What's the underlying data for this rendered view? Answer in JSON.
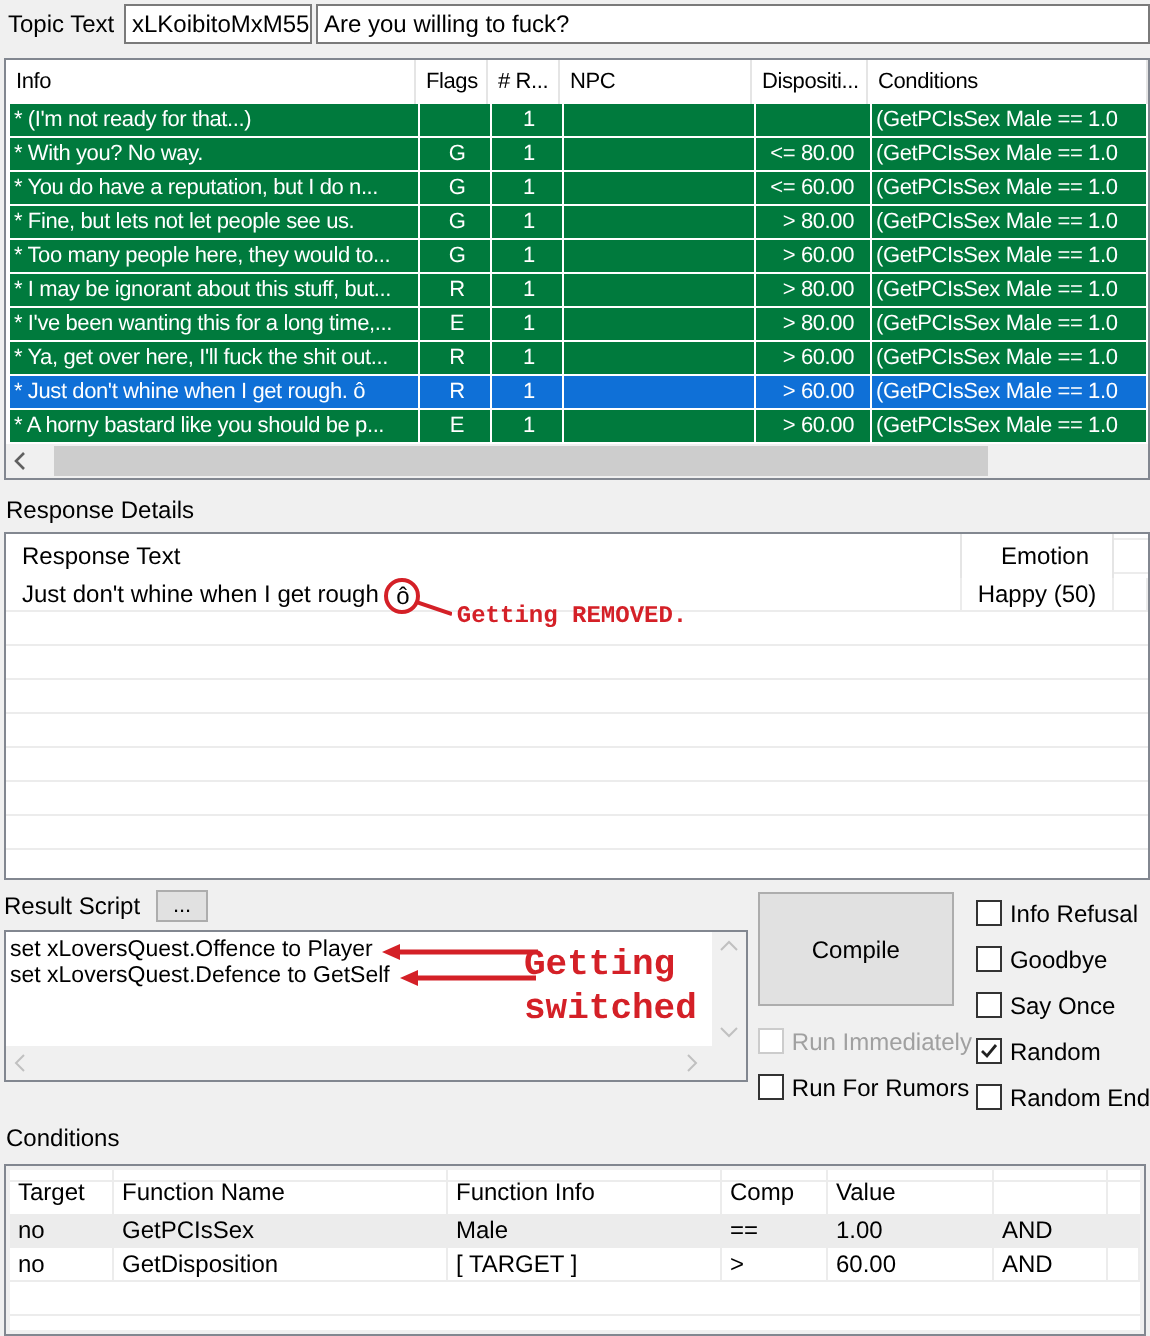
{
  "topic": {
    "label": "Topic Text",
    "id": "xLKoibitoMxM55",
    "text": "Are you willing to fuck?"
  },
  "info_table": {
    "columns": [
      "Info",
      "Flags",
      "# R...",
      "NPC",
      "Dispositi...",
      "Conditions"
    ],
    "rows": [
      {
        "info": "* (I'm not ready for that...)",
        "responses": "1",
        "conditions": "(GetPCIsSex Male == 1.0",
        "selected": false
      },
      {
        "info": "* With you? No way.",
        "flags": "G",
        "responses": "1",
        "disposition": "<= 80.00",
        "conditions": "(GetPCIsSex Male == 1.0",
        "selected": false
      },
      {
        "info": "* You do have  a reputation, but I do n...",
        "flags": "G",
        "responses": "1",
        "disposition": "<= 60.00",
        "conditions": "(GetPCIsSex Male == 1.0",
        "selected": false
      },
      {
        "info": "* Fine, but lets not let people see us.",
        "flags": "G",
        "responses": "1",
        "disposition": "> 80.00",
        "conditions": "(GetPCIsSex Male == 1.0",
        "selected": false
      },
      {
        "info": "* Too many people here, they would to...",
        "flags": "G",
        "responses": "1",
        "disposition": "> 60.00",
        "conditions": "(GetPCIsSex Male == 1.0",
        "selected": false
      },
      {
        "info": "* I may be ignorant about this stuff, but...",
        "flags": "R",
        "responses": "1",
        "disposition": "> 80.00",
        "conditions": "(GetPCIsSex Male == 1.0",
        "selected": false
      },
      {
        "info": "* I've been wanting this for a long time,...",
        "flags": "E",
        "responses": "1",
        "disposition": "> 80.00",
        "conditions": "(GetPCIsSex Male == 1.0",
        "selected": false
      },
      {
        "info": "* Ya, get over here, I'll fuck the shit out...",
        "flags": "R",
        "responses": "1",
        "disposition": "> 60.00",
        "conditions": "(GetPCIsSex Male == 1.0",
        "selected": false
      },
      {
        "info": "* Just don't whine when I get rough. ô",
        "flags": "R",
        "responses": "1",
        "disposition": "> 60.00",
        "conditions": "(GetPCIsSex Male == 1.0",
        "selected": true
      },
      {
        "info": "* A horny bastard like you should be p...",
        "flags": "E",
        "responses": "1",
        "disposition": "> 60.00",
        "conditions": "(GetPCIsSex Male == 1.0",
        "selected": false
      }
    ]
  },
  "response_details": {
    "label": "Response Details",
    "columns": [
      "Response Text",
      "Emotion"
    ],
    "rows": [
      {
        "text": "Just don't whine when I get rough",
        "circled": "ô",
        "emotion": "Happy (50)",
        "note": "Getting REMOVED."
      }
    ]
  },
  "result_script": {
    "label": "Result Script",
    "button": "...",
    "lines": [
      "set xLoversQuest.Offence to Player",
      "set xLoversQuest.Defence to GetSelf"
    ],
    "note": "Getting switched"
  },
  "compile_button": "Compile",
  "middle_checks": [
    {
      "label": "Run Immediately",
      "checked": false,
      "disabled": true
    },
    {
      "label": "Run For Rumors",
      "checked": false,
      "disabled": false
    }
  ],
  "flags": [
    {
      "label": "Info Refusal",
      "checked": false
    },
    {
      "label": "Goodbye",
      "checked": false
    },
    {
      "label": "Say Once",
      "checked": false
    },
    {
      "label": "Random",
      "checked": true
    },
    {
      "label": "Random End",
      "checked": false
    }
  ],
  "conditions": {
    "label": "Conditions",
    "columns": [
      "Target",
      "Function Name",
      "Function Info",
      "Comp",
      "Value"
    ],
    "rows": [
      {
        "target": "no",
        "function_name": "GetPCIsSex",
        "function_info": "Male",
        "comp": "==",
        "value": "1.00",
        "op": "AND",
        "selected": true
      },
      {
        "target": "no",
        "function_name": "GetDisposition",
        "function_info": "[ TARGET ]",
        "comp": ">",
        "value": "60.00",
        "op": "AND",
        "selected": false
      }
    ]
  }
}
